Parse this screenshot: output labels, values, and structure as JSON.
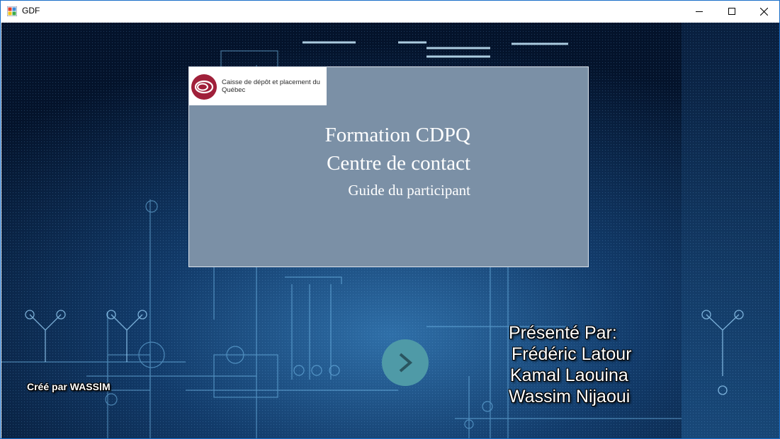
{
  "window": {
    "title": "GDF",
    "controls": [
      "minimize",
      "maximize",
      "close"
    ]
  },
  "card": {
    "logo_text": "Caisse de dépôt et placement du Québec",
    "logo_color": "#a0203a",
    "title_line1": "Formation CDPQ",
    "title_line2": "Centre de contact",
    "subtitle": "Guide du participant",
    "background": "#7b90a6"
  },
  "next_button": {
    "icon": "chevron-right-icon",
    "color": "#4f9aa7"
  },
  "created_by": "Créé par WASSⅠM",
  "presenters": {
    "heading": "Présenté Par:",
    "names": [
      "Frédéric Latour",
      "Kamal Laouina",
      "Wassim Nijaoui"
    ]
  }
}
